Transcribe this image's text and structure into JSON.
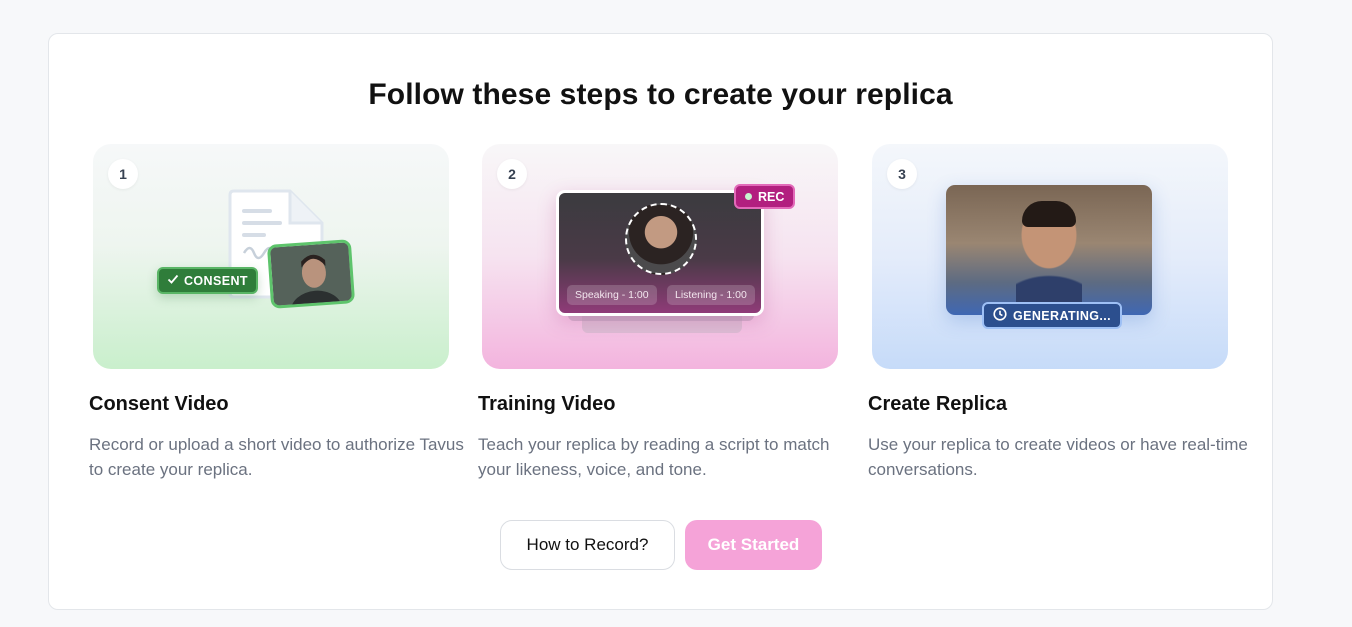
{
  "heading": "Follow these steps to create your replica",
  "steps": [
    {
      "number": "1",
      "title": "Consent Video",
      "description": "Record or upload a short video to authorize Tavus to create your replica.",
      "badge": "CONSENT"
    },
    {
      "number": "2",
      "title": "Training Video",
      "description": "Teach your replica by reading a script to match your likeness, voice, and tone.",
      "badge": "REC",
      "pills": [
        "Speaking - 1:00",
        "Listening - 1:00"
      ]
    },
    {
      "number": "3",
      "title": "Create Replica",
      "description": "Use your replica to create videos or have real-time conversations.",
      "badge": "GENERATING..."
    }
  ],
  "buttons": {
    "how_to_record": "How to Record?",
    "get_started": "Get Started"
  },
  "colors": {
    "accent_pink": "#f5a3d8",
    "consent_green": "#2f7d3a",
    "rec_magenta": "#b21f7f",
    "generating_blue": "#2c4f8e"
  }
}
